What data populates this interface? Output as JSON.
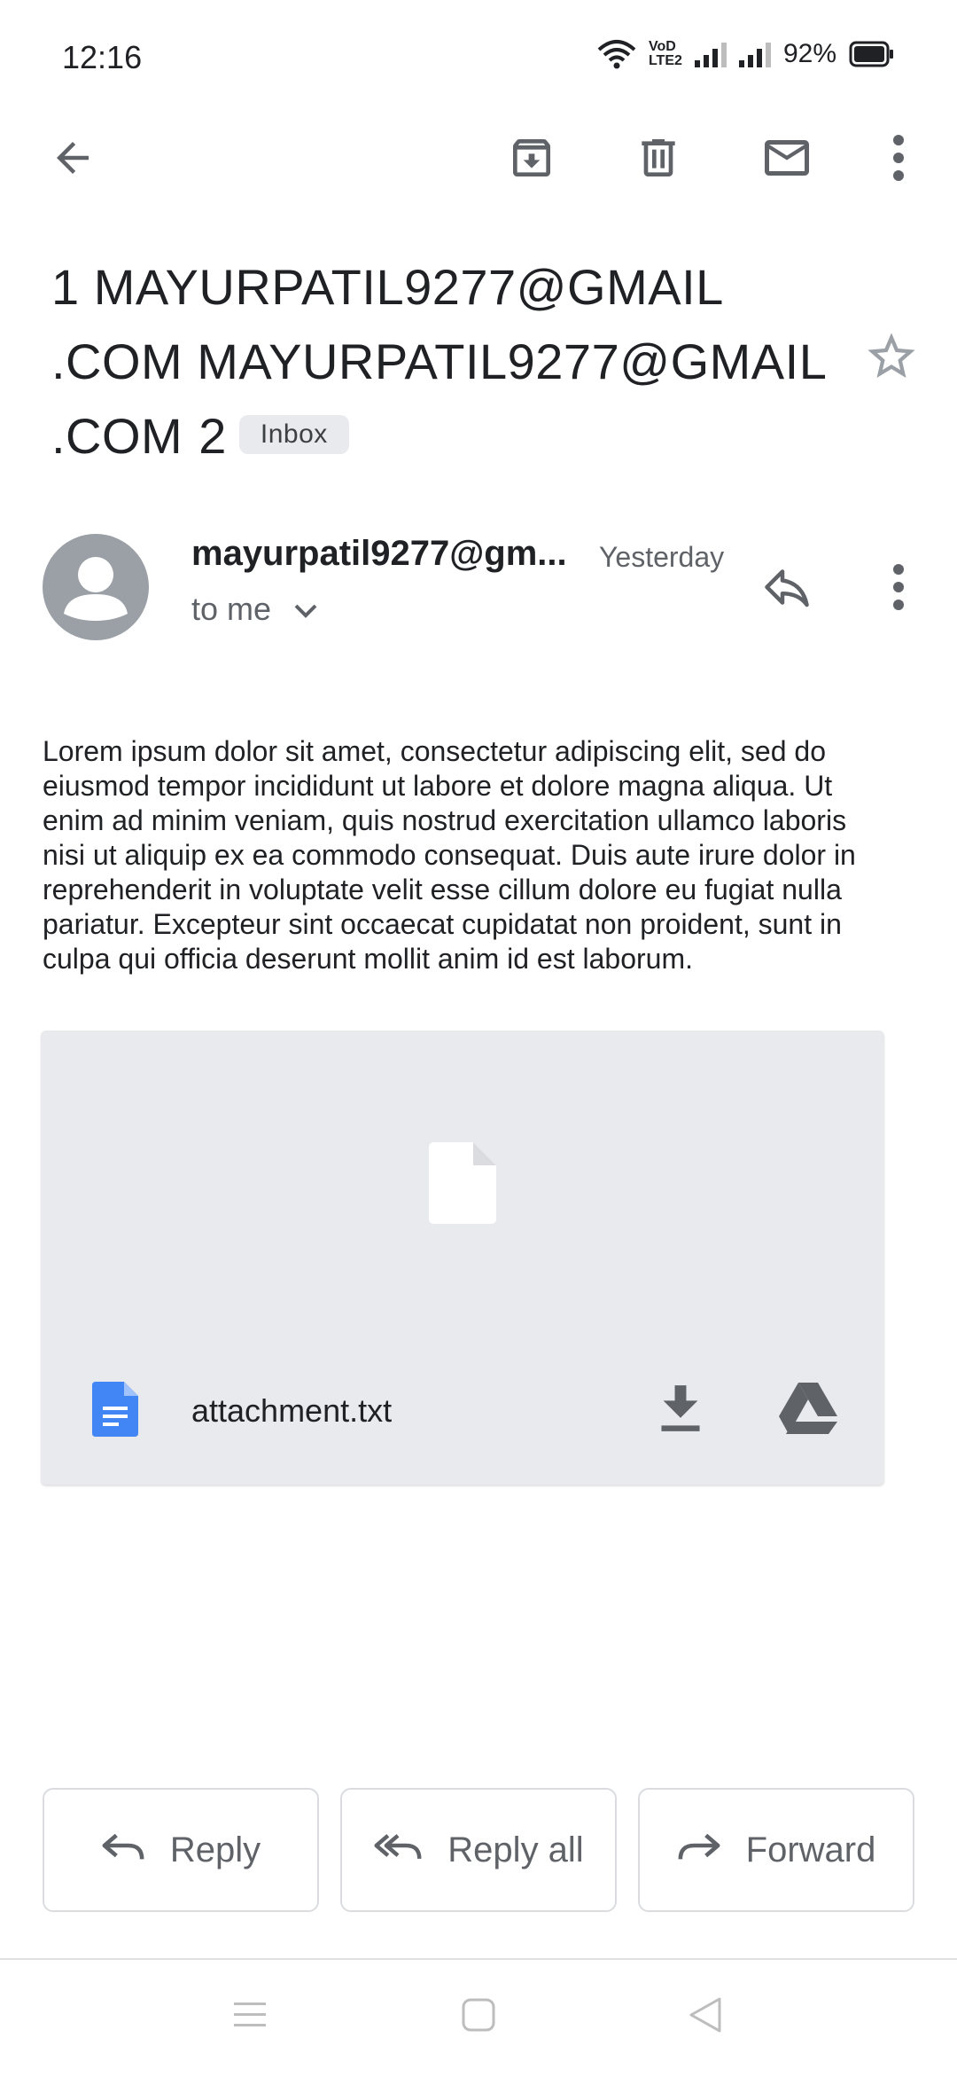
{
  "status_bar": {
    "time": "12:16",
    "network_label": "VoD LTE2",
    "battery": "92%"
  },
  "toolbar": {
    "back_icon": "arrow-left-icon",
    "archive_icon": "archive-icon",
    "delete_icon": "trash-icon",
    "mark_unread_icon": "mail-icon",
    "more_icon": "more-vert-icon"
  },
  "email": {
    "subject_line1": "1 MAYURPATIL9277@GMAIL",
    "subject_line2": ".COM MAYURPATIL9277@GMAIL",
    "subject_line3": ".COM",
    "thread_count": "2",
    "label": "Inbox",
    "sender": "mayurpatil9277@gm...",
    "time": "Yesterday",
    "recipient": "to me",
    "body": "Lorem ipsum dolor sit amet, consectetur adipiscing elit, sed do eiusmod tempor incididunt ut labore et dolore magna aliqua. Ut enim ad minim veniam, quis nostrud exercitation ullamco laboris nisi ut aliquip ex ea commodo consequat. Duis aute irure dolor in reprehenderit in voluptate velit esse cillum dolore eu fugiat nulla pariatur. Excepteur sint occaecat cupidatat non proident, sunt in culpa qui officia deserunt mollit anim id est laborum."
  },
  "attachment": {
    "name": "attachment.txt",
    "file_icon": "docs-file-icon",
    "download_icon": "download-icon",
    "drive_icon": "google-drive-icon"
  },
  "actions": {
    "reply": "Reply",
    "reply_all": "Reply all",
    "forward": "Forward"
  },
  "colors": {
    "accent_blue": "#4285f4",
    "icon_gray": "#5f6368",
    "avatar_gray": "#9aa0a6",
    "card_bg": "#e8eaed"
  }
}
